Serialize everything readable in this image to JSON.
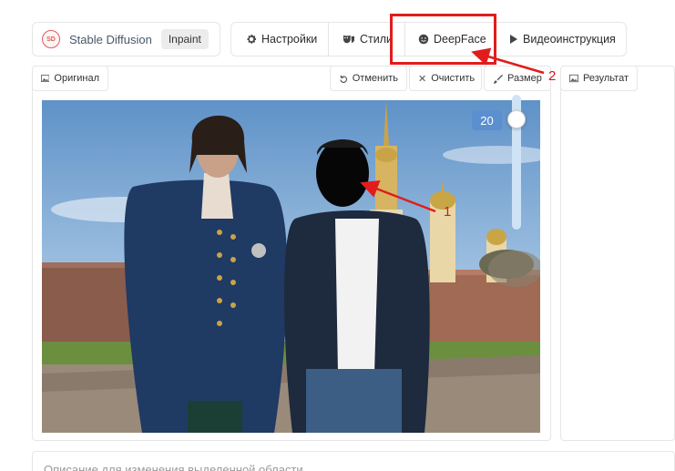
{
  "brand": {
    "logo_text": "SD",
    "title": "Stable Diffusion",
    "mode": "Inpaint"
  },
  "nav": {
    "settings": "Настройки",
    "styles": "Стили",
    "deepface": "DeepFace",
    "video": "Видеоинструкция"
  },
  "editor": {
    "original_tab": "Оригинал",
    "undo": "Отменить",
    "clear": "Очистить",
    "brush_size": "Размер",
    "brush_value": 20
  },
  "result": {
    "tab": "Результат"
  },
  "prompt": {
    "placeholder": "Описание для изменения выделенной области"
  },
  "annotations": {
    "marker_1": "1",
    "marker_2": "2",
    "color": "#e21c1c"
  },
  "icons": {
    "settings": "gear-icon",
    "styles": "mask-icon",
    "deepface": "smiley-icon",
    "video": "play-icon",
    "original": "image-icon",
    "undo": "undo-icon",
    "clear": "close-icon",
    "brush": "brush-icon",
    "result": "image-icon"
  }
}
